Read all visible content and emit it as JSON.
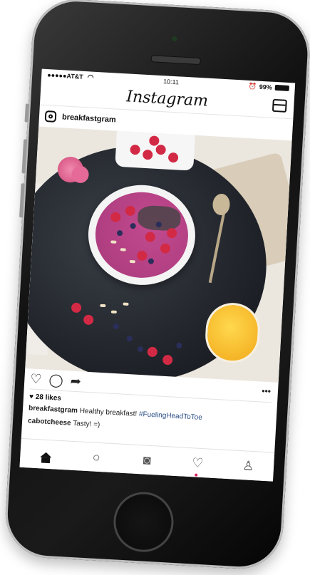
{
  "status_bar": {
    "carrier": "●●●●●AT&T",
    "time": "10:11",
    "battery": "99%"
  },
  "header": {
    "title": "Instagram"
  },
  "post": {
    "username": "breakfastgram",
    "likes": "28 likes",
    "caption_user": "breakfastgram",
    "caption_text": "Healthy breakfast!",
    "caption_hashtag": "#FuelingHeadToToe",
    "comment_user": "cabotcheese",
    "comment_text": "Tasty! =)"
  },
  "colors": {
    "hashtag": "#2b4e86",
    "notification_dot": "#e0245e"
  },
  "icons": {
    "like": "heart-outline-icon",
    "comment": "comment-bubble-icon",
    "share": "share-arrow-icon",
    "more": "more-dots-icon",
    "tabs": [
      "home-icon",
      "search-icon",
      "camera-icon",
      "heart-icon",
      "profile-icon"
    ]
  }
}
